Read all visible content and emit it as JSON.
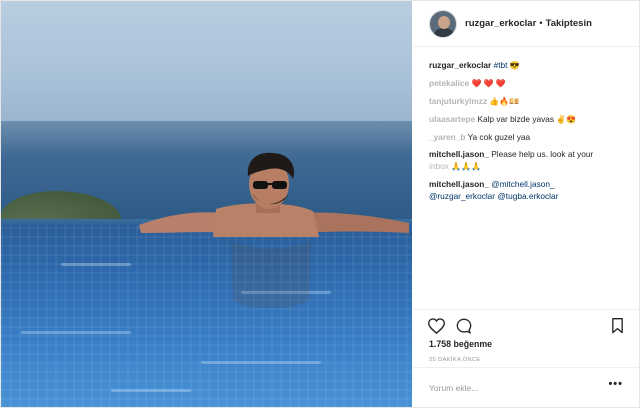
{
  "post": {
    "username": "ruzgar_erkoclar",
    "dot": "•",
    "follow_status": "Takiptesin"
  },
  "comments": [
    {
      "user": "ruzgar_erkoclar",
      "text": "#tbt",
      "emoji": "😎"
    },
    {
      "user": "petekalice",
      "text": "",
      "emoji": "❤️ ❤️ ❤️"
    },
    {
      "user": "tanjuturkylmzz",
      "text": "",
      "emoji": "👍🔥💴"
    },
    {
      "user": "ulaasartepe",
      "text": "Kalp var bizde yavas",
      "emoji": "✌️😍"
    },
    {
      "user": "_yaren_b",
      "text": "Ya cok guzel yaa",
      "emoji": ""
    },
    {
      "user": "mitchell.jason_",
      "text": "Please help us. look at your",
      "text2": "inbox",
      "emoji": "🙏🙏🙏"
    },
    {
      "user": "mitchell.jason_",
      "text": "@mitchell.jason_",
      "text2": "@ruzgar_erkoclar @tugba.erkoclar",
      "emoji": ""
    }
  ],
  "actions": {
    "like_icon": "heart-icon",
    "comment_icon": "comment-icon",
    "save_icon": "bookmark-icon",
    "likes_label": "1.758 beğenme",
    "timestamp": "25 DAKİKA ÖNCE"
  },
  "add_comment": {
    "placeholder": "Yorum ekle...",
    "more": "•••"
  },
  "colors": {
    "link": "#003569",
    "text": "#262626",
    "muted": "#999999",
    "border": "#efefef"
  }
}
